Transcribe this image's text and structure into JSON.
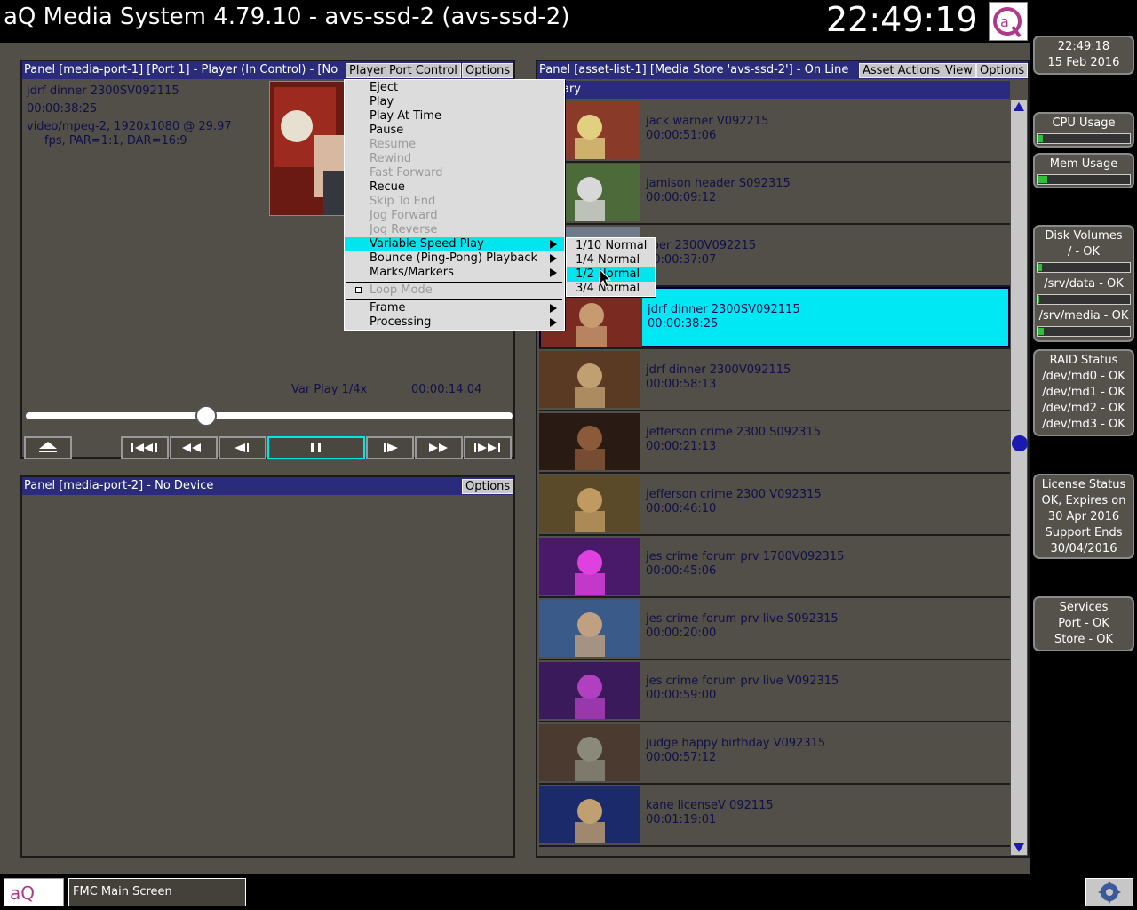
{
  "header": {
    "title": "aQ Media System 4.79.10 - avs-ssd-2 (avs-ssd-2)",
    "clock": "22:49:19"
  },
  "status": {
    "time": "22:49:18",
    "date": "15 Feb 2016",
    "cpu_label": "CPU Usage",
    "cpu_level": 0.05,
    "mem_label": "Mem Usage",
    "mem_level": 0.1,
    "disk_title": "Disk Volumes",
    "disk_root": "/ - OK",
    "disk_root_level": 0.04,
    "disk_data": "/srv/data - OK",
    "disk_data_level": 0.01,
    "disk_media": "/srv/media - OK",
    "disk_media_level": 0.06,
    "raid_title": "RAID Status",
    "raid": [
      "/dev/md0 - OK",
      "/dev/md1 - OK",
      "/dev/md2 - OK",
      "/dev/md3 - OK"
    ],
    "license": [
      "License Status",
      "OK, Expires on",
      "30 Apr 2016",
      "Support Ends",
      "30/04/2016"
    ],
    "services": [
      "Services",
      "Port - OK",
      "Store - OK"
    ]
  },
  "port1": {
    "header": "Panel [media-port-1] [Port 1] - Player (In Control) - [No",
    "btn_player": "Player",
    "btn_port_control": "Port Control",
    "btn_options": "Options",
    "clip_name": "jdrf dinner 2300SV092115",
    "clip_duration": "00:00:38:25",
    "format_line1": "video/mpeg-2, 1920x1080 @ 29.97",
    "format_line2": "fps, PAR=1:1, DAR=16:9",
    "play_status": "Var Play 1/4x",
    "timecode": "00:00:14:04",
    "position": 0.37
  },
  "port2": {
    "header": "Panel [media-port-2] - No Device",
    "btn_options": "Options"
  },
  "assets": {
    "header": "Panel [asset-list-1] [Media Store 'avs-ssd-2'] - On Line",
    "btn_actions": "Asset Actions",
    "btn_view": "View",
    "btn_options": "Options",
    "subheader": "ary",
    "items": [
      {
        "name": "jack warner V092215",
        "duration": "00:00:51:06"
      },
      {
        "name": "jamison header S092315",
        "duration": "00:00:09:12"
      },
      {
        "name": "sper 2300V092215",
        "duration": "00:00:37:07"
      },
      {
        "name": "jdrf dinner 2300SV092115",
        "duration": "00:00:38:25"
      },
      {
        "name": "jdrf dinner 2300V092115",
        "duration": "00:00:58:13"
      },
      {
        "name": "jefferson crime 2300 S092315",
        "duration": "00:00:21:13"
      },
      {
        "name": "jefferson crime 2300 V092315",
        "duration": "00:00:46:10"
      },
      {
        "name": "jes crime forum prv 1700V092315",
        "duration": "00:00:45:06"
      },
      {
        "name": "jes crime forum prv live S092315",
        "duration": "00:00:20:00"
      },
      {
        "name": "jes crime forum prv live V092315",
        "duration": "00:00:59:00"
      },
      {
        "name": "judge happy birthday V092315",
        "duration": "00:00:57:12"
      },
      {
        "name": "kane licenseV 092115",
        "duration": "00:01:19:01"
      }
    ]
  },
  "player_menu": {
    "eject": "Eject",
    "play": "Play",
    "play_at_time": "Play At Time",
    "pause": "Pause",
    "resume": "Resume",
    "rewind": "Rewind",
    "fast_forward": "Fast Forward",
    "recue": "Recue",
    "skip_to_end": "Skip To End",
    "jog_forward": "Jog Forward",
    "jog_reverse": "Jog Reverse",
    "variable_speed": "Variable Speed Play",
    "bounce": "Bounce (Ping-Pong) Playback",
    "marks": "Marks/Markers",
    "loop_mode": "Loop Mode",
    "frame": "Frame",
    "processing": "Processing"
  },
  "speed_submenu": {
    "s1": "1/10 Normal",
    "s2": "1/4 Normal",
    "s3": "1/2 Normal",
    "s4": "3/4 Normal"
  },
  "taskbar": {
    "fmc": "FMC Main Screen"
  },
  "colors": {
    "panel_header": "#2a2b7c",
    "highlight": "#00e5ee",
    "text": "#10104a"
  }
}
